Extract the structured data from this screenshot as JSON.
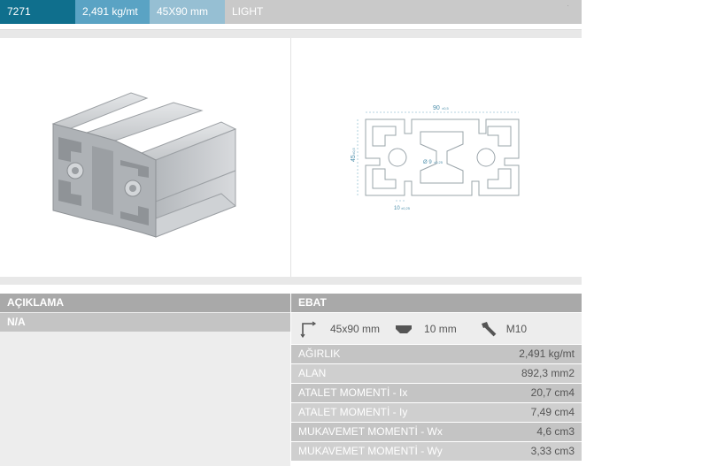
{
  "header": {
    "code": "7271",
    "weight": "2,491 kg/mt",
    "size": "45X90 mm",
    "type": "LIGHT"
  },
  "drawing": {
    "width_label": "90",
    "width_tol": "±0,5",
    "height_label": "45",
    "height_tol": "±0,5",
    "bore_label": "Ø 9",
    "bore_tol": "±0,25",
    "slot_label": "10",
    "slot_tol": "±0,25"
  },
  "description": {
    "title": "AÇIKLAMA",
    "value": "N/A"
  },
  "dimensions": {
    "title": "EBAT",
    "size": "45x90 mm",
    "slot": "10 mm",
    "bolt": "M10"
  },
  "specs": [
    {
      "label": "AĞIRLIK",
      "value": "2,491 kg/mt"
    },
    {
      "label": "ALAN",
      "value": "892,3 mm2"
    },
    {
      "label": "ATALET MOMENTİ - Ix",
      "value": "20,7 cm4"
    },
    {
      "label": "ATALET MOMENTİ - Iy",
      "value": "7,49 cm4"
    },
    {
      "label": "MUKAVEMET MOMENTİ - Wx",
      "value": "4,6 cm3"
    },
    {
      "label": "MUKAVEMET MOMENTİ - Wy",
      "value": "3,33 cm3"
    }
  ],
  "colors": {
    "header_dark": "#0f6f8d",
    "header_mid": "#5aa3c4",
    "header_light": "#96bfd3",
    "panel_header": "#a9a9a9"
  }
}
